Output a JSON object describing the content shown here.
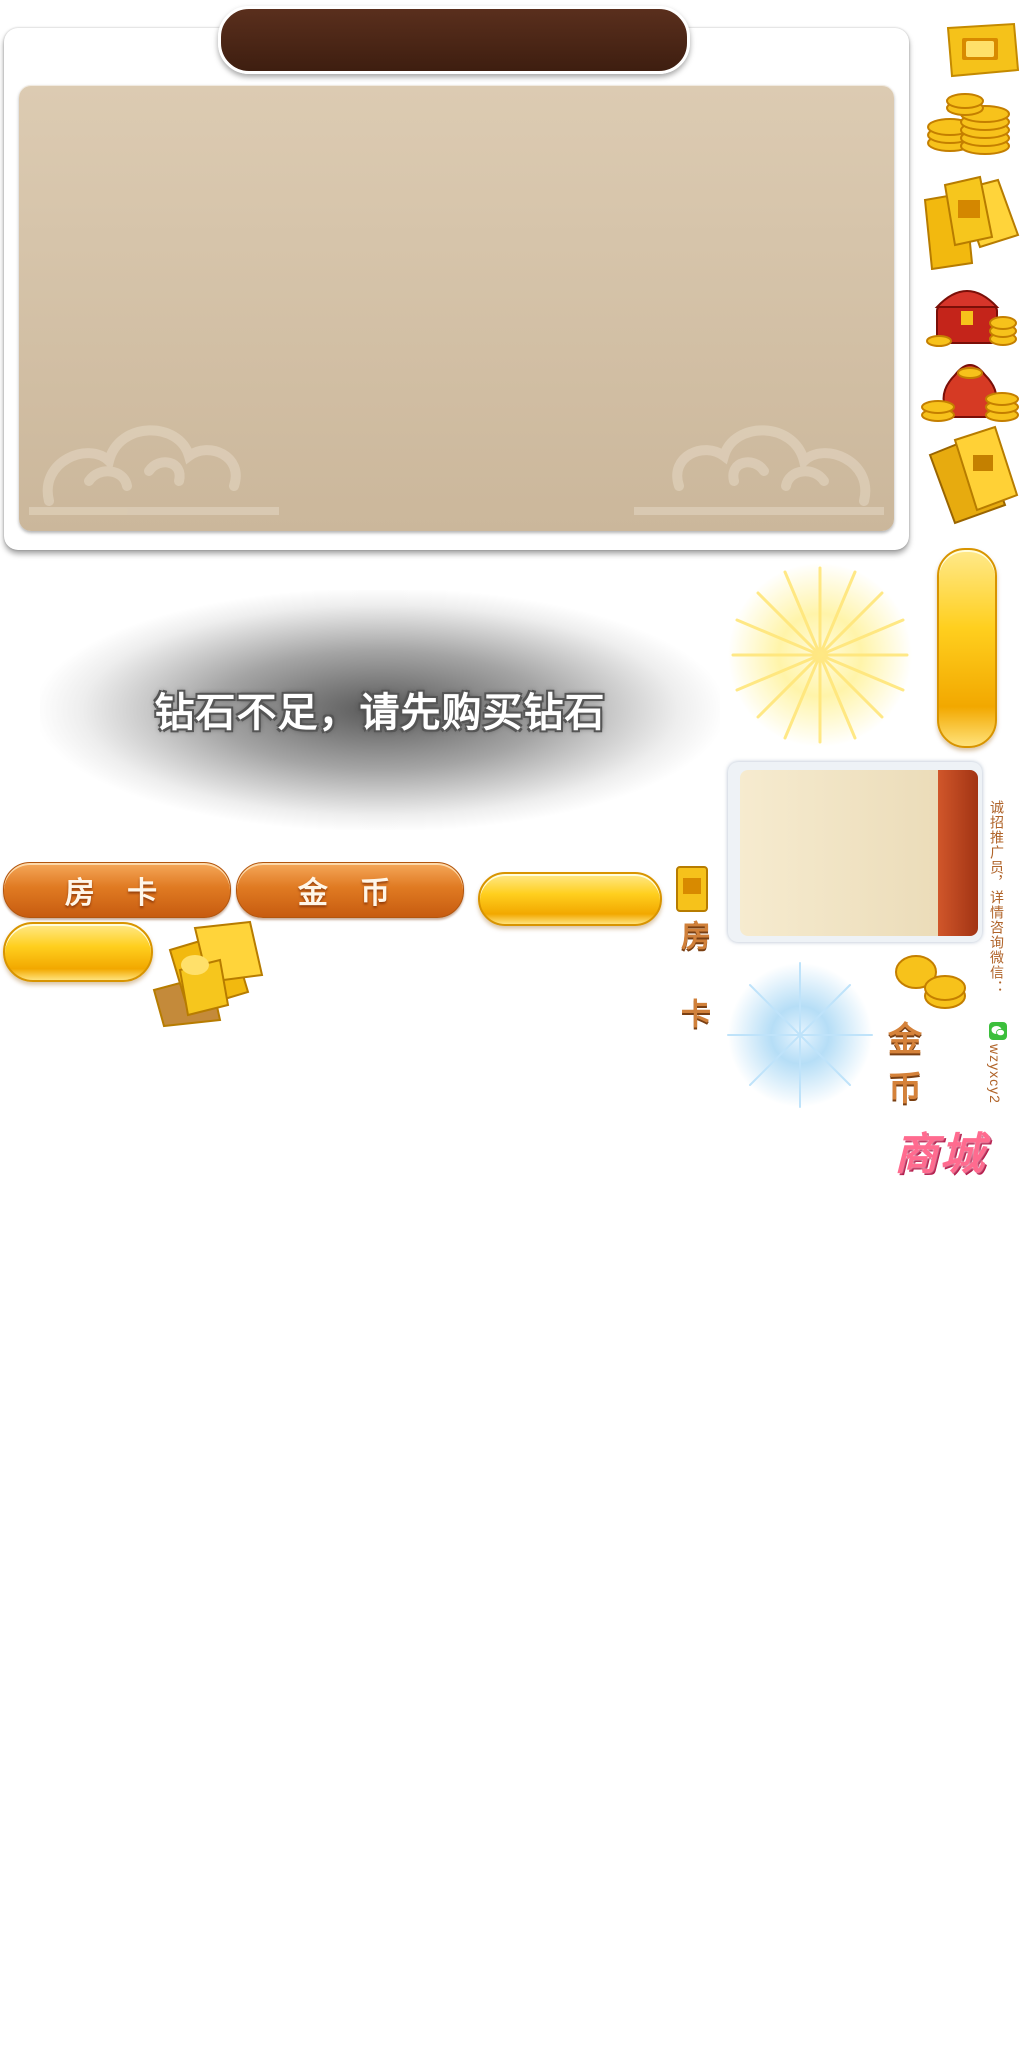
{
  "toast": {
    "message": "钻石不足，请先购买钻石"
  },
  "tabs": [
    {
      "label": "房 卡"
    },
    {
      "label": "金 币"
    }
  ],
  "side_labels": {
    "room_card": "房 卡",
    "gold_coin": "金 币",
    "shop": "商城"
  },
  "promo": {
    "text": "诚招推广员，详情咨询微信：",
    "wechat_id": "wzyxcy2"
  },
  "colors": {
    "title_bar": "#4a2414",
    "panel": "#d6c4a9",
    "tab_orange": "#e07a22",
    "gold": "#ffcf1e",
    "shop_pink": "#ff5d86"
  },
  "icons": [
    "room-card-icon",
    "coin-pile-icon",
    "card-stack-icon",
    "treasure-chest-icon",
    "coin-bag-icon",
    "card-wallet-icon",
    "sunburst-icon",
    "blue-sparkle-icon",
    "wechat-icon",
    "card-pile-icon"
  ]
}
